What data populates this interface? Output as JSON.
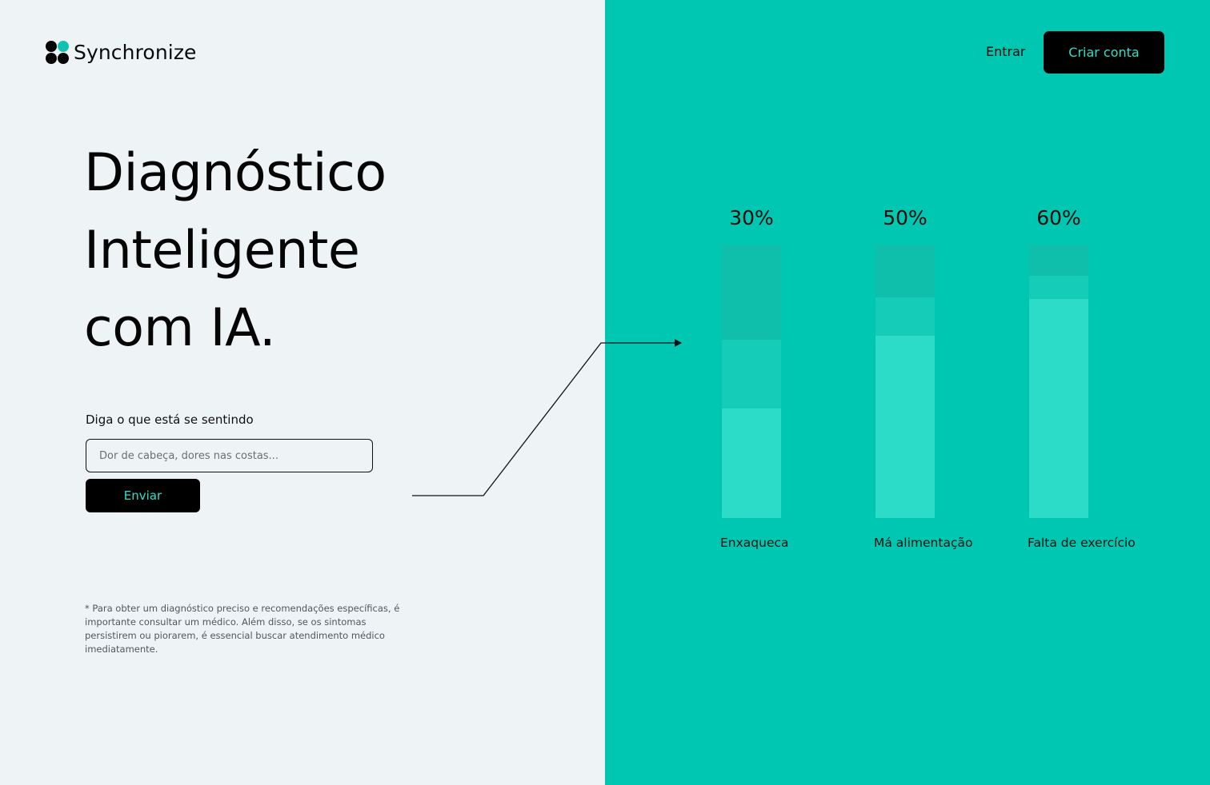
{
  "brand": {
    "name": "Synchronize"
  },
  "nav": {
    "login_label": "Entrar",
    "signup_label": "Criar conta"
  },
  "hero": {
    "title_lines": [
      "Diagnóstico",
      "Inteligente",
      "com IA."
    ]
  },
  "form": {
    "label": "Diga o que está se sentindo",
    "input_value": "",
    "input_placeholder": "Dor de cabeça, dores nas costas...",
    "submit_label": "Enviar"
  },
  "disclaimer": "* Para obter um diagnóstico preciso e recomendações específicas, é importante consultar um médico. Além disso, se os sintomas persistirem ou piorarem, é essencial buscar atendimento médico imediatamente.",
  "colors": {
    "left_background": "#eef3f6",
    "right_background": "#00c7b2",
    "accent_text": "#2be0c8",
    "bar_track": "#0fbfab",
    "bar_mid": "#14ccb7",
    "bar_fill": "#2ddcc8"
  },
  "chart_data": {
    "type": "bar",
    "categories": [
      "Enxaqueca",
      "Má alimentação",
      "Falta de exercício"
    ],
    "values": [
      30,
      50,
      60
    ],
    "value_labels": [
      "30%",
      "50%",
      "60%"
    ],
    "ylim": [
      0,
      75
    ],
    "grid": false
  }
}
